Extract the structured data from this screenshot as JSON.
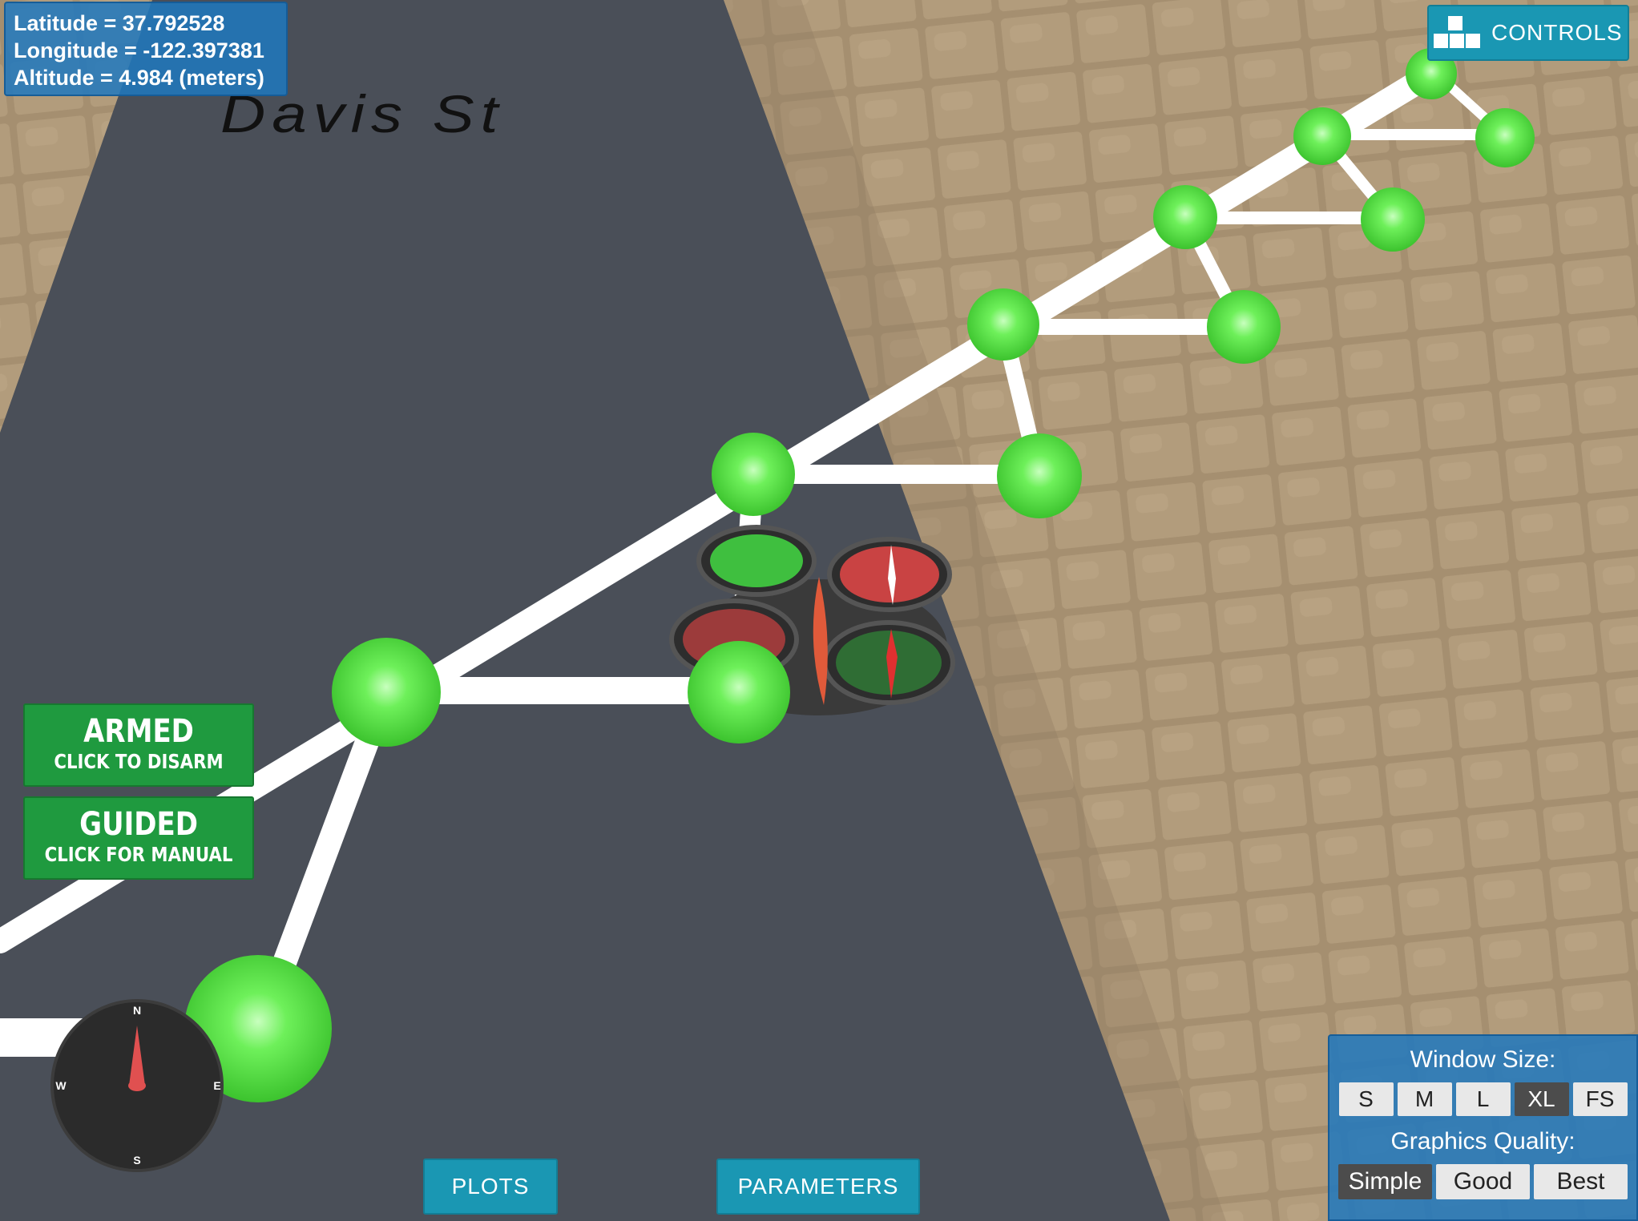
{
  "telemetry": {
    "latitude": "Latitude = 37.792528",
    "longitude": "Longitude = -122.397381",
    "altitude": "Altitude = 4.984 (meters)"
  },
  "street_name": "Davis St",
  "controls": {
    "label": "CONTROLS",
    "icon": "grid-blocks-icon"
  },
  "mode_buttons": {
    "armed": {
      "title": "ARMED",
      "subtitle": "CLICK TO DISARM"
    },
    "guided": {
      "title": "GUIDED",
      "subtitle": "CLICK FOR MANUAL"
    }
  },
  "bottom_buttons": {
    "plots": "PLOTS",
    "parameters": "PARAMETERS"
  },
  "compass": {
    "n": "N",
    "e": "E",
    "s": "S",
    "w": "W"
  },
  "window_size": {
    "heading": "Window Size:",
    "options": [
      "S",
      "M",
      "L",
      "XL",
      "FS"
    ],
    "selected": "XL"
  },
  "graphics_quality": {
    "heading": "Graphics Quality:",
    "options": [
      "Simple",
      "Good",
      "Best"
    ],
    "selected": "Simple"
  },
  "colors": {
    "road": "#4a4f58",
    "pavement": "#a38c6c",
    "waypoint": "#5ce64a",
    "path": "#ffffff",
    "panel_blue": "#1e78be",
    "button_teal": "#1a97b3",
    "mode_green": "#1f9a3f",
    "compass_needle": "#e05050"
  }
}
